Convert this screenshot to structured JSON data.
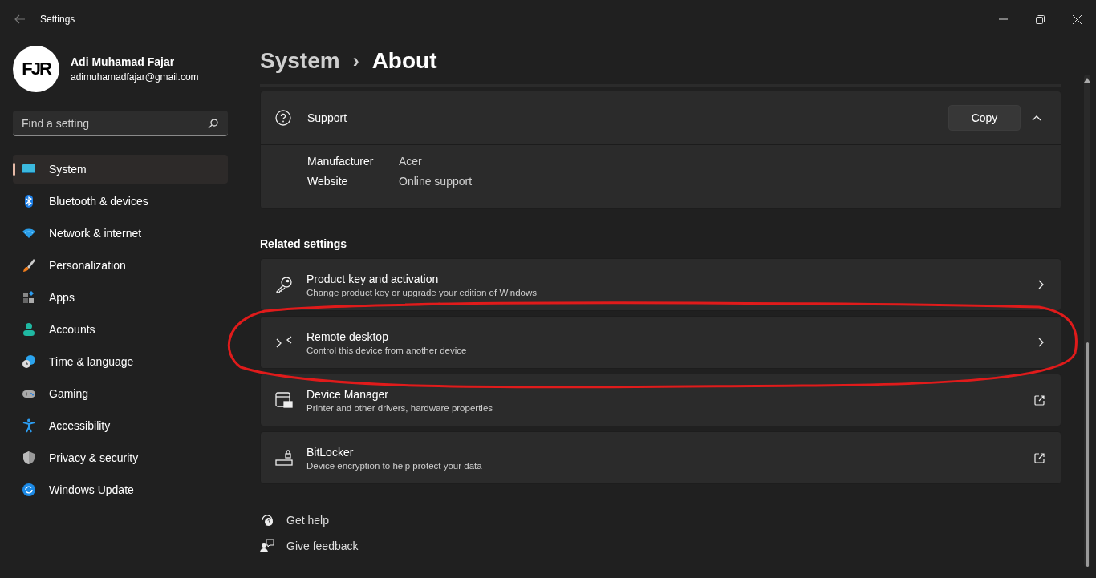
{
  "window": {
    "title": "Settings"
  },
  "profile": {
    "name": "Adi Muhamad Fajar",
    "email": "adimuhamadfajar@gmail.com",
    "avatar_text": "FJR"
  },
  "search": {
    "placeholder": "Find a setting"
  },
  "sidebar": {
    "items": [
      {
        "label": "System",
        "selected": true
      },
      {
        "label": "Bluetooth & devices",
        "selected": false
      },
      {
        "label": "Network & internet",
        "selected": false
      },
      {
        "label": "Personalization",
        "selected": false
      },
      {
        "label": "Apps",
        "selected": false
      },
      {
        "label": "Accounts",
        "selected": false
      },
      {
        "label": "Time & language",
        "selected": false
      },
      {
        "label": "Gaming",
        "selected": false
      },
      {
        "label": "Accessibility",
        "selected": false
      },
      {
        "label": "Privacy & security",
        "selected": false
      },
      {
        "label": "Windows Update",
        "selected": false
      }
    ]
  },
  "breadcrumb": {
    "parent": "System",
    "separator": "›",
    "current": "About"
  },
  "support": {
    "title": "Support",
    "button": "Copy",
    "expanded": true,
    "rows": [
      {
        "label": "Manufacturer",
        "value": "Acer"
      },
      {
        "label": "Website",
        "value": "Online support"
      }
    ]
  },
  "related": {
    "heading": "Related settings",
    "items": [
      {
        "kind": "link",
        "title": "Product key and activation",
        "subtitle": "Change product key or upgrade your edition of Windows"
      },
      {
        "kind": "link",
        "title": "Remote desktop",
        "subtitle": "Control this device from another device"
      },
      {
        "kind": "external",
        "title": "Device Manager",
        "subtitle": "Printer and other drivers, hardware properties"
      },
      {
        "kind": "external",
        "title": "BitLocker",
        "subtitle": "Device encryption to help protect your data"
      }
    ]
  },
  "footer_links": [
    "Get help",
    "Give feedback"
  ]
}
